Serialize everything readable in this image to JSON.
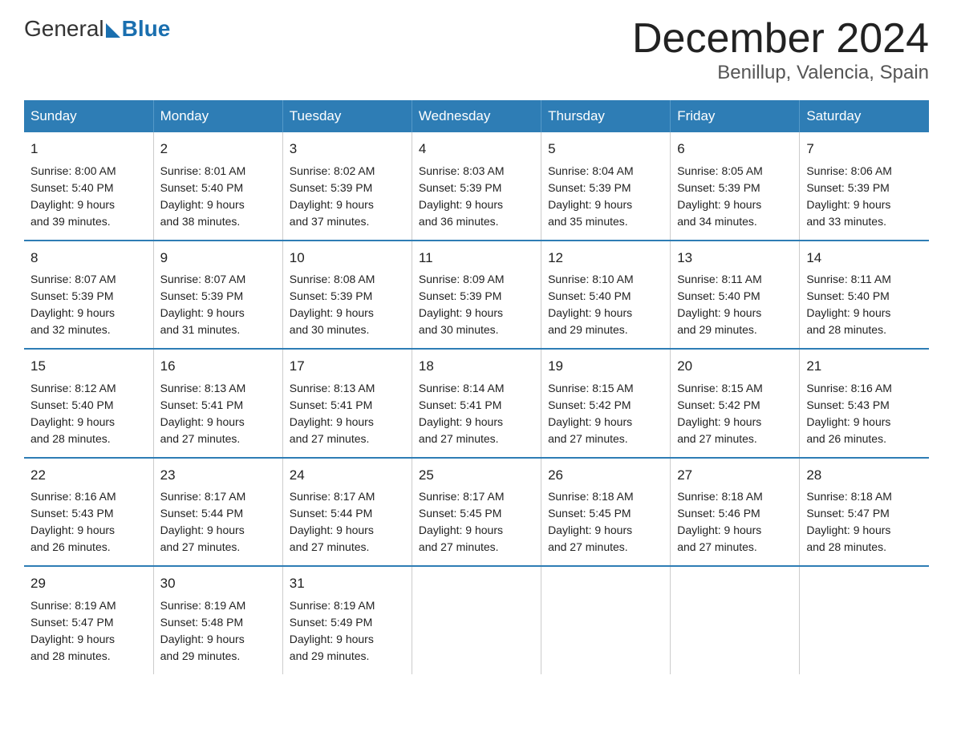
{
  "logo": {
    "general": "General",
    "blue": "Blue"
  },
  "title": "December 2024",
  "subtitle": "Benillup, Valencia, Spain",
  "days_header": [
    "Sunday",
    "Monday",
    "Tuesday",
    "Wednesday",
    "Thursday",
    "Friday",
    "Saturday"
  ],
  "weeks": [
    [
      {
        "day": "1",
        "sunrise": "8:00 AM",
        "sunset": "5:40 PM",
        "daylight": "9 hours and 39 minutes."
      },
      {
        "day": "2",
        "sunrise": "8:01 AM",
        "sunset": "5:40 PM",
        "daylight": "9 hours and 38 minutes."
      },
      {
        "day": "3",
        "sunrise": "8:02 AM",
        "sunset": "5:39 PM",
        "daylight": "9 hours and 37 minutes."
      },
      {
        "day": "4",
        "sunrise": "8:03 AM",
        "sunset": "5:39 PM",
        "daylight": "9 hours and 36 minutes."
      },
      {
        "day": "5",
        "sunrise": "8:04 AM",
        "sunset": "5:39 PM",
        "daylight": "9 hours and 35 minutes."
      },
      {
        "day": "6",
        "sunrise": "8:05 AM",
        "sunset": "5:39 PM",
        "daylight": "9 hours and 34 minutes."
      },
      {
        "day": "7",
        "sunrise": "8:06 AM",
        "sunset": "5:39 PM",
        "daylight": "9 hours and 33 minutes."
      }
    ],
    [
      {
        "day": "8",
        "sunrise": "8:07 AM",
        "sunset": "5:39 PM",
        "daylight": "9 hours and 32 minutes."
      },
      {
        "day": "9",
        "sunrise": "8:07 AM",
        "sunset": "5:39 PM",
        "daylight": "9 hours and 31 minutes."
      },
      {
        "day": "10",
        "sunrise": "8:08 AM",
        "sunset": "5:39 PM",
        "daylight": "9 hours and 30 minutes."
      },
      {
        "day": "11",
        "sunrise": "8:09 AM",
        "sunset": "5:39 PM",
        "daylight": "9 hours and 30 minutes."
      },
      {
        "day": "12",
        "sunrise": "8:10 AM",
        "sunset": "5:40 PM",
        "daylight": "9 hours and 29 minutes."
      },
      {
        "day": "13",
        "sunrise": "8:11 AM",
        "sunset": "5:40 PM",
        "daylight": "9 hours and 29 minutes."
      },
      {
        "day": "14",
        "sunrise": "8:11 AM",
        "sunset": "5:40 PM",
        "daylight": "9 hours and 28 minutes."
      }
    ],
    [
      {
        "day": "15",
        "sunrise": "8:12 AM",
        "sunset": "5:40 PM",
        "daylight": "9 hours and 28 minutes."
      },
      {
        "day": "16",
        "sunrise": "8:13 AM",
        "sunset": "5:41 PM",
        "daylight": "9 hours and 27 minutes."
      },
      {
        "day": "17",
        "sunrise": "8:13 AM",
        "sunset": "5:41 PM",
        "daylight": "9 hours and 27 minutes."
      },
      {
        "day": "18",
        "sunrise": "8:14 AM",
        "sunset": "5:41 PM",
        "daylight": "9 hours and 27 minutes."
      },
      {
        "day": "19",
        "sunrise": "8:15 AM",
        "sunset": "5:42 PM",
        "daylight": "9 hours and 27 minutes."
      },
      {
        "day": "20",
        "sunrise": "8:15 AM",
        "sunset": "5:42 PM",
        "daylight": "9 hours and 27 minutes."
      },
      {
        "day": "21",
        "sunrise": "8:16 AM",
        "sunset": "5:43 PM",
        "daylight": "9 hours and 26 minutes."
      }
    ],
    [
      {
        "day": "22",
        "sunrise": "8:16 AM",
        "sunset": "5:43 PM",
        "daylight": "9 hours and 26 minutes."
      },
      {
        "day": "23",
        "sunrise": "8:17 AM",
        "sunset": "5:44 PM",
        "daylight": "9 hours and 27 minutes."
      },
      {
        "day": "24",
        "sunrise": "8:17 AM",
        "sunset": "5:44 PM",
        "daylight": "9 hours and 27 minutes."
      },
      {
        "day": "25",
        "sunrise": "8:17 AM",
        "sunset": "5:45 PM",
        "daylight": "9 hours and 27 minutes."
      },
      {
        "day": "26",
        "sunrise": "8:18 AM",
        "sunset": "5:45 PM",
        "daylight": "9 hours and 27 minutes."
      },
      {
        "day": "27",
        "sunrise": "8:18 AM",
        "sunset": "5:46 PM",
        "daylight": "9 hours and 27 minutes."
      },
      {
        "day": "28",
        "sunrise": "8:18 AM",
        "sunset": "5:47 PM",
        "daylight": "9 hours and 28 minutes."
      }
    ],
    [
      {
        "day": "29",
        "sunrise": "8:19 AM",
        "sunset": "5:47 PM",
        "daylight": "9 hours and 28 minutes."
      },
      {
        "day": "30",
        "sunrise": "8:19 AM",
        "sunset": "5:48 PM",
        "daylight": "9 hours and 29 minutes."
      },
      {
        "day": "31",
        "sunrise": "8:19 AM",
        "sunset": "5:49 PM",
        "daylight": "9 hours and 29 minutes."
      },
      null,
      null,
      null,
      null
    ]
  ],
  "labels": {
    "sunrise": "Sunrise:",
    "sunset": "Sunset:",
    "daylight": "Daylight:"
  }
}
